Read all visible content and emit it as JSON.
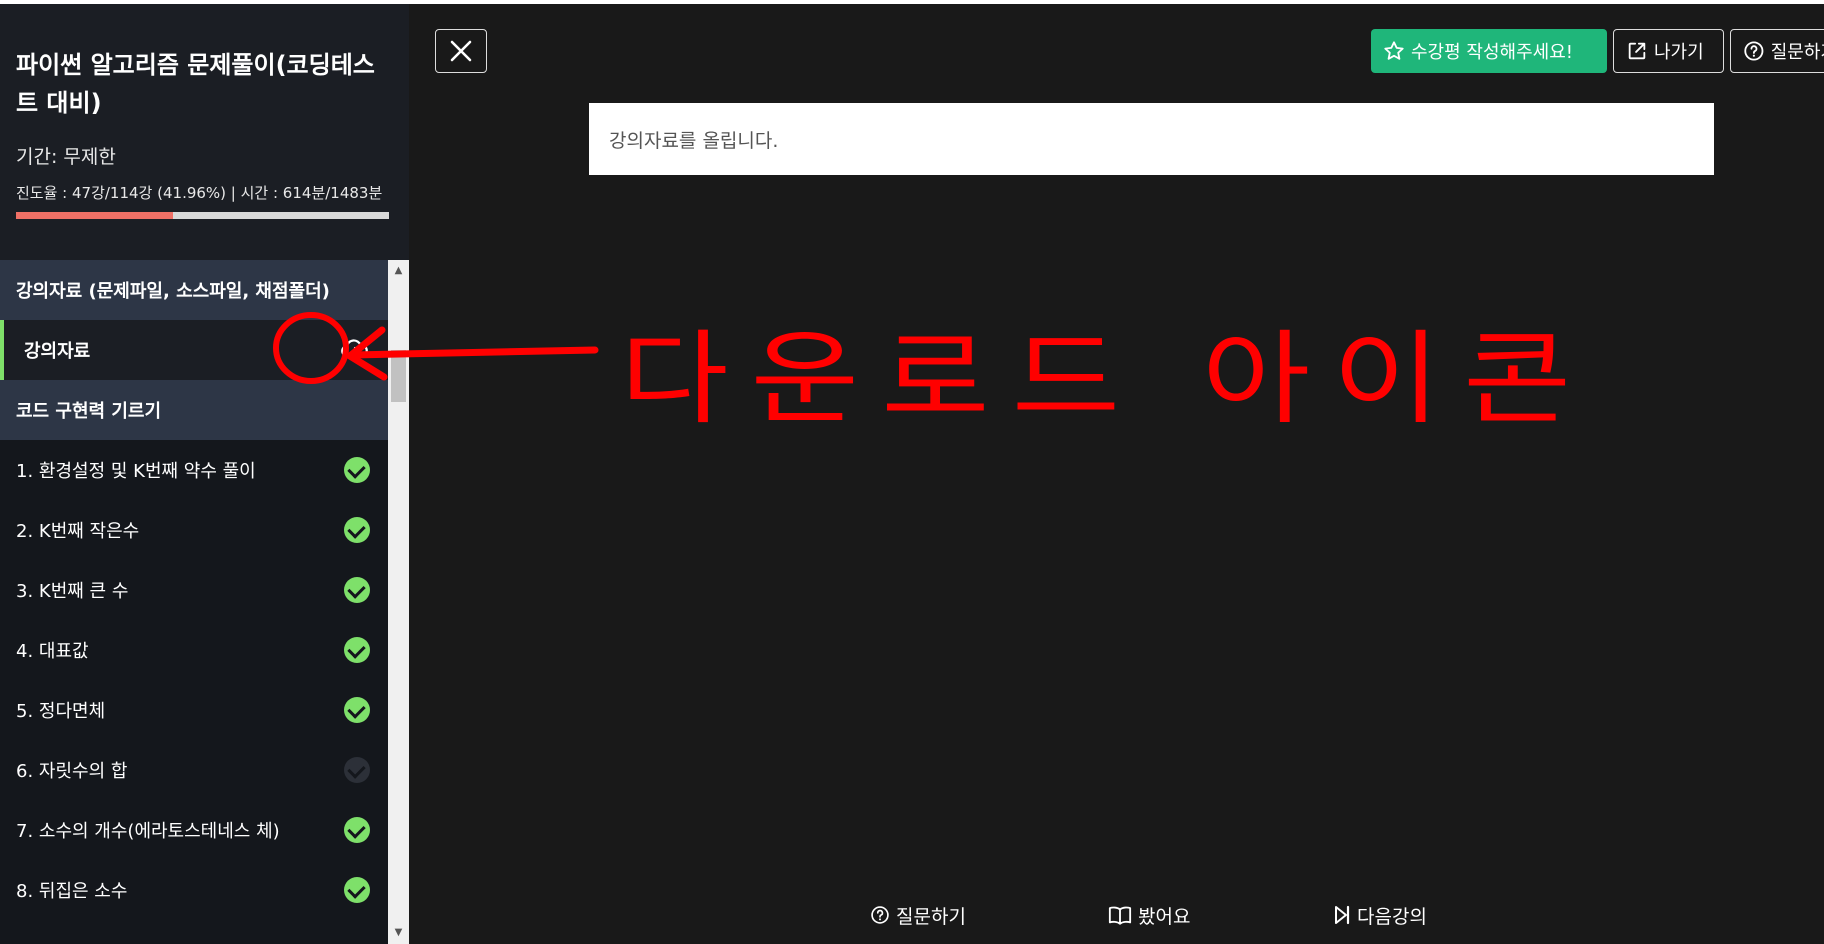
{
  "course": {
    "title": "파이썬 알고리즘 문제풀이(코딩테스트 대비)",
    "period": "기간: 무제한",
    "progress_text": "진도율 : 47강/114강 (41.96%) | 시간 : 614분/1483분",
    "progress_fraction": 0.4196
  },
  "sections": [
    {
      "title": "강의자료 (문제파일, 소스파일, 채점폴더)",
      "items": [
        {
          "label": "강의자료",
          "icon": "cloud-download-icon",
          "active": true
        }
      ]
    },
    {
      "title": "코드 구현력 기르기",
      "items": [
        {
          "label": "1. 환경설정 및 K번째 약수 풀이",
          "done": true
        },
        {
          "label": "2. K번째 작은수",
          "done": true
        },
        {
          "label": "3. K번째 큰 수",
          "done": true
        },
        {
          "label": "4. 대표값",
          "done": true
        },
        {
          "label": "5. 정다면체",
          "done": true
        },
        {
          "label": "6. 자릿수의 합",
          "done": false
        },
        {
          "label": "7. 소수의 개수(에라토스테네스 체)",
          "done": true
        },
        {
          "label": "8. 뒤집은 소수",
          "done": true
        }
      ]
    }
  ],
  "header": {
    "review_label": "수강평 작성해주세요!",
    "exit_label": "나가기",
    "qna_label": "질문하기"
  },
  "notice": "강의자료를 올립니다.",
  "bottom": {
    "ask_label": "질문하기",
    "seen_label": "봤어요",
    "next_label": "다음강의"
  },
  "annotation": {
    "text": "다운로드 아이콘",
    "color": "#ff0000"
  },
  "colors": {
    "accent_green": "#1fb67a",
    "check_green": "#7ee06a",
    "progress_red": "#f07066",
    "section_bg": "#2d3646"
  }
}
